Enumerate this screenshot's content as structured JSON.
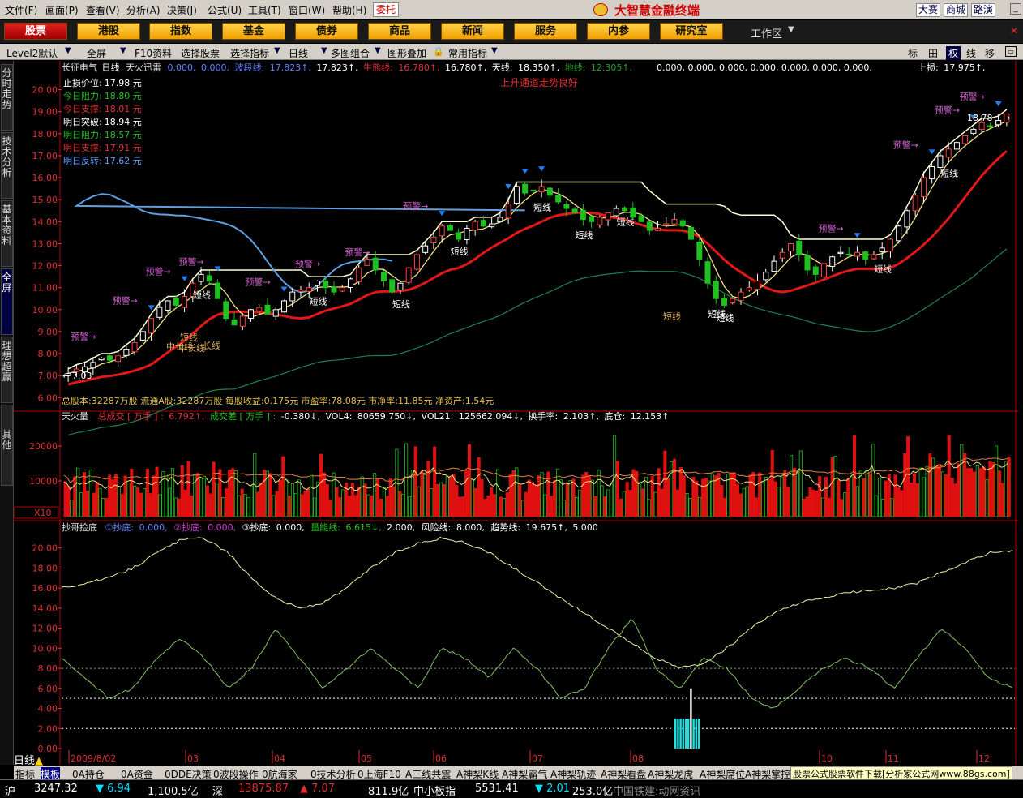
{
  "menu": [
    "文件(F)",
    "画面(P)",
    "查看(V)",
    "分析(A)",
    "决策(J)",
    "公式(U)",
    "工具(T)",
    "窗口(W)",
    "帮助(H)"
  ],
  "trust_label": "委托",
  "brand": "大智慧金融终端",
  "right_links": [
    "大赛",
    "商城",
    "路演"
  ],
  "nav": [
    "股票",
    "港股",
    "指数",
    "基金",
    "债券",
    "商品",
    "新闻",
    "服务",
    "内参",
    "研究室"
  ],
  "workarea": "工作区",
  "toolbar": [
    "Level2默认",
    "全屏",
    "F10资料",
    "选择股票",
    "选择指标",
    "日线",
    "多图组合",
    "图形叠加",
    "常用指标"
  ],
  "toolbar_right": [
    "标",
    "田",
    "权",
    "线",
    "移"
  ],
  "sidebar": [
    "分时走势",
    "技术分析",
    "基本资料",
    "全屏",
    "理想超赢",
    "其他"
  ],
  "main_header": {
    "stock": "长征电气",
    "period": "日线",
    "indicator": "天火迅雷",
    "p1": "0.000,",
    "p2": "0.000,",
    "band_label": "波段线:",
    "band_val": "17.823↑,",
    "band_val2": "17.823↑,",
    "bull_label": "牛熊线:",
    "bull_val": "16.780↑,",
    "bull_val2": "16.780↑,",
    "sky_label": "天线:",
    "sky_val": "18.350↑,",
    "ground_label": "地线:",
    "ground_val": "12.305↑,",
    "tail": "0.000, 0.000, 0.000, 0.000, 0.000, 0.000, 0.000,",
    "stop_label": "上损:",
    "stop_val": "17.975↑,"
  },
  "trend_msg": "上升通道走势良好",
  "price_box": [
    {
      "label": "止损价位:",
      "value": "17.98 元",
      "color": "#ffffff"
    },
    {
      "label": "今日阻力:",
      "value": "18.80 元",
      "color": "#20c020"
    },
    {
      "label": "今日支撑:",
      "value": "18.01 元",
      "color": "#e03030"
    },
    {
      "label": "明日突破:",
      "value": "18.94 元",
      "color": "#ffffff"
    },
    {
      "label": "明日阻力:",
      "value": "18.57 元",
      "color": "#20c020"
    },
    {
      "label": "明日支撑:",
      "value": "17.91 元",
      "color": "#e03030"
    },
    {
      "label": "明日反转:",
      "value": "17.62 元",
      "color": "#60a0ff"
    }
  ],
  "price_axis": [
    "20.00",
    "19.00",
    "18.00",
    "17.00",
    "16.00",
    "15.00",
    "14.00",
    "13.00",
    "12.00",
    "11.00",
    "10.00",
    "9.00",
    "8.00",
    "7.00",
    "6.00"
  ],
  "price_extremes": {
    "high": "18.78",
    "low": "7.03"
  },
  "signals": {
    "warn": [
      "预警",
      "预警",
      "预警",
      "预警",
      "预警",
      "预警",
      "预警",
      "预警",
      "预警",
      "预警",
      "预警",
      "预警"
    ],
    "short": [
      "短线",
      "短线",
      "短线",
      "短线",
      "短线",
      "短线",
      "短线",
      "短线",
      "短线",
      "短线",
      "短线"
    ],
    "mid": [
      "中长线",
      "中长线",
      "长线",
      "短线",
      "短线"
    ]
  },
  "fundamentals": "总股本:32287万股 流通A股:32287万股 每股收益:0.175元 市盈率:78.08元 市净率:11.85元 净资产:1.54元",
  "volume_header": {
    "name": "天火量",
    "total_label": "总成交 [ 万手 ] :",
    "total_val": "6.792↑,",
    "diff_label": "成交差 [ 万手 ] :",
    "diff_val": "-0.380↓,",
    "vol4_label": "VOL4:",
    "vol4_val": "80659.750↓,",
    "vol21_label": "VOL21:",
    "vol21_val": "125662.094↓,",
    "turnover_label": "换手率:",
    "turnover_val": "2.103↑,",
    "base_label": "底仓:",
    "base_val": "12.153↑"
  },
  "volume_axis": [
    "20000",
    "10000"
  ],
  "volume_unit": "X10",
  "osc_header": {
    "name": "抄哥捡底",
    "b1_label": "①抄底:",
    "b1": "0.000,",
    "b2_label": "②抄底:",
    "b2": "0.000,",
    "b3_label": "③抄底:",
    "b3": "0.000,",
    "energy_label": "量能线:",
    "energy": "6.615↓,",
    "e2": "2.000,",
    "risk_label": "风险线:",
    "risk": "8.000,",
    "trend_label": "趋势线:",
    "trend": "19.675↑,",
    "t2": "5.000"
  },
  "osc_axis": [
    "20.00",
    "18.00",
    "16.00",
    "14.00",
    "12.00",
    "10.00",
    "8.00",
    "6.00",
    "4.00",
    "2.00",
    "0.00"
  ],
  "date_axis": [
    "2009/8/02",
    "03",
    "04",
    "05",
    "06",
    "07",
    "08",
    "10",
    "11",
    "12"
  ],
  "period_label": "日线",
  "bottom_tabs": [
    "指标",
    "模板",
    "0A持仓",
    "0A资金",
    "0DDE决策",
    "0波段操作",
    "0航海家",
    "0技术分析",
    "0上海F10",
    "A三线共震",
    "A神梨K线",
    "A神梨霸气",
    "A神梨轨迹",
    "A神梨看盘",
    "A神梨龙虎",
    "A神梨席位",
    "A神梨掌控"
  ],
  "ad": "股票公式股票软件下载[分析家公式网www.88gs.com]",
  "status": [
    {
      "label": "沪",
      "color": "#ffffff"
    },
    {
      "label": "3247.32",
      "color": "#ffffff"
    },
    {
      "label": "▼ 6.94",
      "color": "#00e0ff"
    },
    {
      "label": "1,100.5亿",
      "color": "#ffffff"
    },
    {
      "label": "深",
      "color": "#ffffff"
    },
    {
      "label": "13875.87",
      "color": "#e03030"
    },
    {
      "label": "▲ 7.07",
      "color": "#e03030"
    },
    {
      "label": "811.9亿",
      "color": "#ffffff"
    },
    {
      "label": "中小板指",
      "color": "#ffffff"
    },
    {
      "label": "5531.41",
      "color": "#ffffff"
    },
    {
      "label": "▼ 2.01",
      "color": "#00e0ff"
    },
    {
      "label": "253.0亿",
      "color": "#ffffff"
    },
    {
      "label": "中国铁建:动网资讯",
      "color": "#888888"
    }
  ],
  "chart_data": {
    "type": "candlestick",
    "y_range": [
      6,
      20.5
    ],
    "closes": [
      7.1,
      7.3,
      7.4,
      7.6,
      7.8,
      7.7,
      7.9,
      8.2,
      8.5,
      9.0,
      9.6,
      10.1,
      10.4,
      10.2,
      10.6,
      11.2,
      11.6,
      11.3,
      10.5,
      9.6,
      9.3,
      9.7,
      10.0,
      10.1,
      9.8,
      10.0,
      10.4,
      10.8,
      10.9,
      11.0,
      11.3,
      11.0,
      10.8,
      11.0,
      11.4,
      11.9,
      12.3,
      11.8,
      11.3,
      10.8,
      11.2,
      11.9,
      12.5,
      12.9,
      13.3,
      13.8,
      13.6,
      13.2,
      13.7,
      14.0,
      13.8,
      13.9,
      14.2,
      14.8,
      15.6,
      15.3,
      15.4,
      15.6,
      15.2,
      14.9,
      14.6,
      14.4,
      14.1,
      14.0,
      14.2,
      14.4,
      14.6,
      14.5,
      14.2,
      14.0,
      13.6,
      13.7,
      13.9,
      14.1,
      13.8,
      13.2,
      12.3,
      11.2,
      10.5,
      10.2,
      10.5,
      10.8,
      11.0,
      11.3,
      11.7,
      12.2,
      12.6,
      13.0,
      12.5,
      11.8,
      11.6,
      12.1,
      12.4,
      12.6,
      12.5,
      12.6,
      12.3,
      12.5,
      12.8,
      13.2,
      13.8,
      14.5,
      15.2,
      16.0,
      16.5,
      17.0,
      17.3,
      17.6,
      17.9,
      18.2,
      18.5,
      18.3,
      18.6,
      18.9
    ],
    "osc_trend": [
      16,
      16.5,
      17,
      18,
      19.5,
      20.8,
      21,
      19.5,
      17,
      15,
      14,
      14.5,
      16,
      18,
      19.5,
      20.5,
      21,
      20.5,
      19.5,
      18,
      16.5,
      15,
      13.5,
      12,
      10.5,
      9,
      8,
      8.5,
      10,
      12,
      13.5,
      14.5,
      15,
      15.5,
      15.8,
      16,
      16.5,
      17.5,
      18.5,
      19.5,
      19.7
    ],
    "osc_energy": [
      9,
      7,
      5,
      6,
      9,
      11,
      9,
      6,
      8,
      12,
      9,
      6,
      8,
      10,
      8,
      6,
      10,
      9,
      7,
      10,
      8,
      5,
      6,
      10,
      13,
      8,
      6,
      9,
      8,
      5,
      4,
      6,
      8,
      9,
      8,
      6,
      9,
      12,
      10,
      7,
      6
    ],
    "osc_bars": [
      3,
      3,
      3,
      3,
      3,
      3,
      6,
      3,
      3,
      3
    ],
    "risk_line": 8,
    "energy_line": 5,
    "base_line": 2
  }
}
